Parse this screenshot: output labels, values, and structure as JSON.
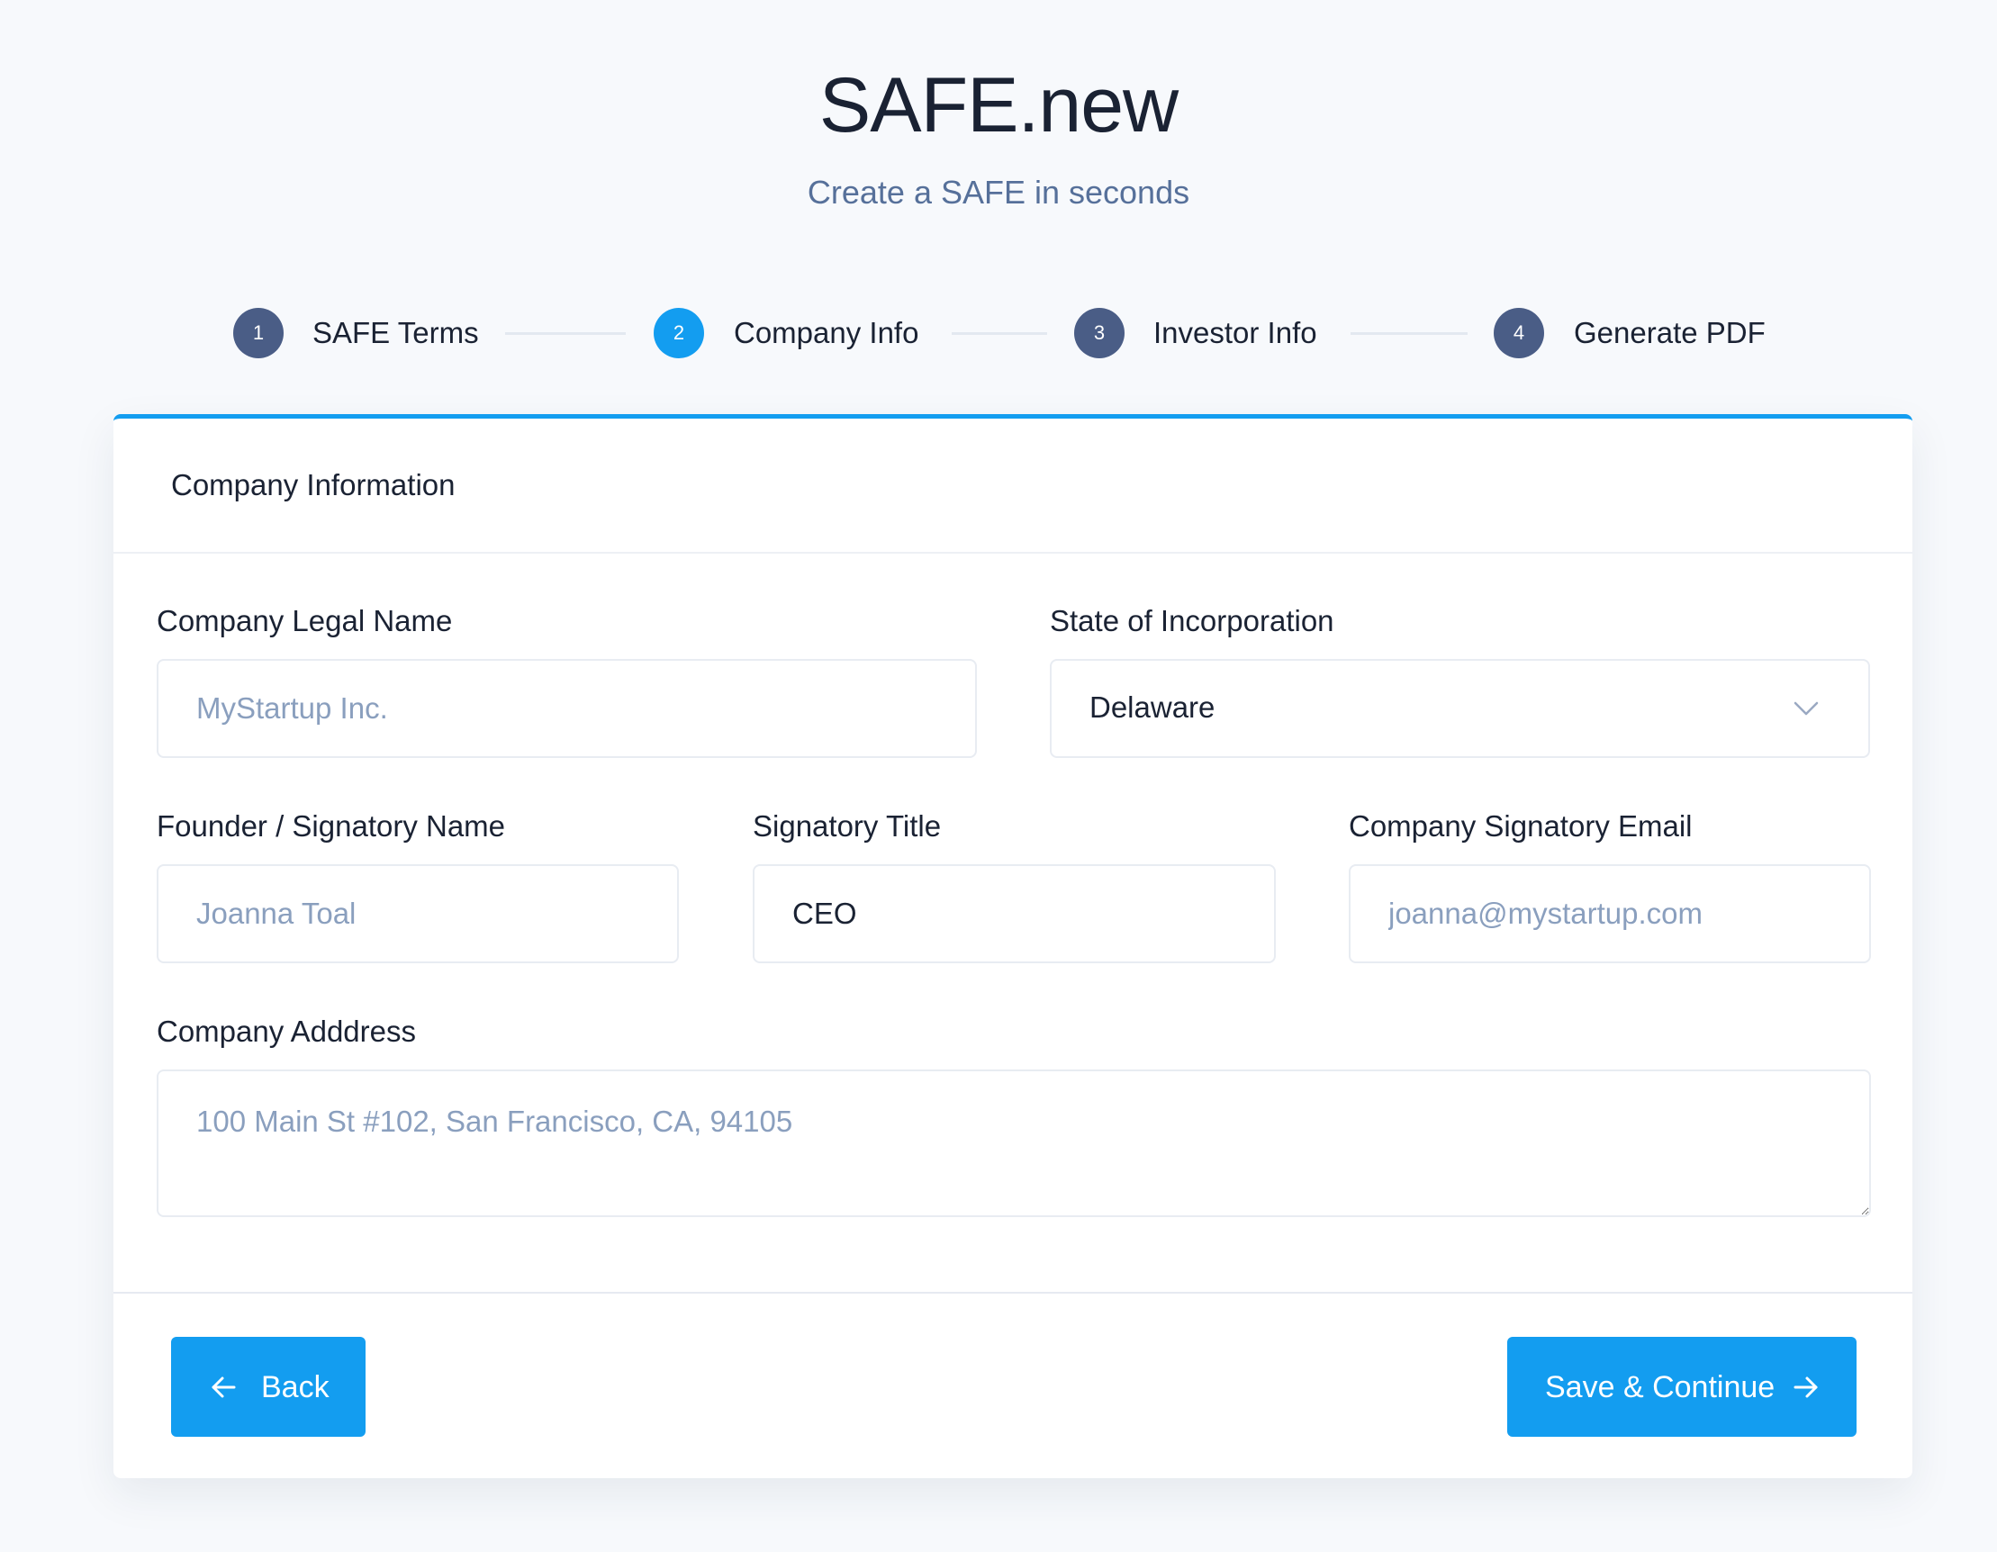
{
  "header": {
    "title": "SAFE.new",
    "subtitle": "Create a SAFE in seconds"
  },
  "stepper": {
    "active_step": 2,
    "steps": [
      {
        "number": "1",
        "label": "SAFE Terms"
      },
      {
        "number": "2",
        "label": "Company Info"
      },
      {
        "number": "3",
        "label": "Investor Info"
      },
      {
        "number": "4",
        "label": "Generate PDF"
      }
    ]
  },
  "card": {
    "title": "Company Information",
    "fields": {
      "legal_name": {
        "label": "Company Legal Name",
        "value": "",
        "placeholder": "MyStartup Inc."
      },
      "state": {
        "label": "State of Incorporation",
        "value": "Delaware"
      },
      "founder_name": {
        "label": "Founder / Signatory Name",
        "value": "",
        "placeholder": "Joanna Toal"
      },
      "signatory_title": {
        "label": "Signatory Title",
        "value": "CEO",
        "placeholder": ""
      },
      "signatory_email": {
        "label": "Company Signatory Email",
        "value": "",
        "placeholder": "joanna@mystartup.com"
      },
      "address": {
        "label": "Company Adddress",
        "value": "",
        "placeholder": "100 Main St #102, San Francisco, CA, 94105"
      }
    },
    "buttons": {
      "back_label": "Back",
      "save_label": "Save & Continue"
    }
  },
  "colors": {
    "accent": "#139df0",
    "step_inactive": "#4a5d86",
    "placeholder": "#8a9fbe",
    "background": "#f7f9fc"
  },
  "icons": {
    "back": "arrow-left-icon",
    "save": "arrow-right-icon",
    "select": "chevron-down-icon"
  }
}
